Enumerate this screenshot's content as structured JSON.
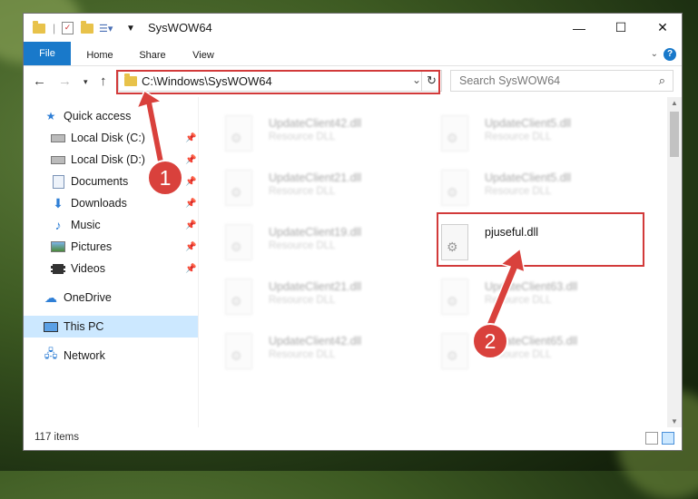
{
  "window": {
    "title": "SysWOW64",
    "controls": {
      "minimize": "—",
      "maximize": "☐",
      "close": "✕"
    }
  },
  "ribbon": {
    "tabs": [
      "File",
      "Home",
      "Share",
      "View"
    ],
    "help_icon": "?"
  },
  "address": {
    "path": "C:\\Windows\\SysWOW64",
    "search_placeholder": "Search SysWOW64"
  },
  "sidebar": {
    "quick_access": "Quick access",
    "items": [
      {
        "label": "Local Disk (C:)",
        "icon": "drive-icon",
        "pinned": true
      },
      {
        "label": "Local Disk (D:)",
        "icon": "drive-icon",
        "pinned": true
      },
      {
        "label": "Documents",
        "icon": "documents-icon",
        "pinned": true
      },
      {
        "label": "Downloads",
        "icon": "downloads-icon",
        "pinned": true
      },
      {
        "label": "Music",
        "icon": "music-icon",
        "pinned": true
      },
      {
        "label": "Pictures",
        "icon": "pictures-icon",
        "pinned": true
      },
      {
        "label": "Videos",
        "icon": "videos-icon",
        "pinned": true
      }
    ],
    "onedrive": "OneDrive",
    "this_pc": "This PC",
    "network": "Network"
  },
  "files": {
    "left": [
      {
        "name": "UpdateClient42.dll",
        "desc": "Resource DLL"
      },
      {
        "name": "UpdateClient21.dll",
        "desc": "Resource DLL"
      },
      {
        "name": "UpdateClient19.dll",
        "desc": "Resource DLL"
      },
      {
        "name": "UpdateClient21.dll",
        "desc": "Resource DLL"
      },
      {
        "name": "UpdateClient42.dll",
        "desc": "Resource DLL"
      }
    ],
    "right": [
      {
        "name": "UpdateClient5.dll",
        "desc": "Resource DLL"
      },
      {
        "name": "UpdateClient5.dll",
        "desc": "Resource DLL"
      },
      {
        "name": "pjuseful.dll",
        "desc": ""
      },
      {
        "name": "UpdateClient63.dll",
        "desc": "Resource DLL"
      },
      {
        "name": "UpdateClient65.dll",
        "desc": "Resource DLL"
      }
    ]
  },
  "status": {
    "item_count": "117 items"
  },
  "annotations": {
    "step1": "1",
    "step2": "2",
    "color": "#d9413c"
  }
}
